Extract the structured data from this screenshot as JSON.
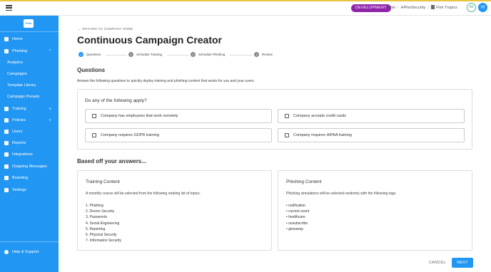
{
  "topbar": {
    "env_badge": "DEVELOPMENT",
    "breadcrumb": [
      "Phin",
      "HPhinSecurity",
      "Flint Tropics"
    ],
    "user_initials": "Ah",
    "org_initial": "H"
  },
  "sidebar": {
    "logo_text": "Phin",
    "items": [
      {
        "label": "Home",
        "icon": "home-icon"
      },
      {
        "label": "Phishing",
        "icon": "hook-icon",
        "chevron": "^"
      },
      {
        "label": "Analytics",
        "sub": true
      },
      {
        "label": "Campaigns",
        "sub": true
      },
      {
        "label": "Template Library",
        "sub": true
      },
      {
        "label": "Campaign Presets",
        "sub": true
      },
      {
        "label": "Training",
        "icon": "graduation-cap-icon",
        "chevron": "v"
      },
      {
        "label": "Policies",
        "icon": "policy-icon",
        "chevron": "v"
      },
      {
        "label": "Users",
        "icon": "users-icon"
      },
      {
        "label": "Reports",
        "icon": "chart-icon"
      },
      {
        "label": "Integrations",
        "icon": "integrations-icon"
      },
      {
        "label": "Outgoing Messages",
        "icon": "message-icon"
      },
      {
        "label": "Branding",
        "icon": "palette-icon"
      },
      {
        "label": "Settings",
        "icon": "gear-icon"
      }
    ],
    "help": "Help & Support"
  },
  "main": {
    "return_link": "RETURN TO COMPANY HOME",
    "title": "Continuous Campaign Creator",
    "steps": [
      {
        "num": "1",
        "label": "Questions"
      },
      {
        "num": "2",
        "label": "Schedule Training"
      },
      {
        "num": "3",
        "label": "Schedule Phishing"
      },
      {
        "num": "4",
        "label": "Review"
      }
    ],
    "questions_heading": "Questions",
    "questions_desc": "Answer the following questions to quickly deploy training and phishing content that works for you and your users.",
    "apply_title": "Do any of the following apply?",
    "options": [
      "Company has employees that work remotely",
      "Company accepts credit cards",
      "Company requires GDPR training",
      "Company requires HIPAA training"
    ],
    "based_heading": "Based off your answers...",
    "training": {
      "title": "Training Content",
      "desc": "A monthly course will be selected from the following rotating list of topics.",
      "topics": [
        "1. Phishing",
        "2. Device Security",
        "3. Passwords",
        "4. Social Engineering",
        "5. Reporting",
        "6. Physical Security",
        "7. Information Security"
      ]
    },
    "phishing": {
      "title": "Phishing Content",
      "desc": "Phishing simulations will be selected randomly with the following tags.",
      "tags": [
        "• notification",
        "• current event",
        "• healthcare",
        "• unsubscribe",
        "• giveaway"
      ]
    },
    "cancel_label": "CANCEL",
    "next_label": "NEXT"
  },
  "colors": {
    "accent": "#2196f3",
    "env_badge": "#8e24aa",
    "topbar_stripe": "#e8c440"
  }
}
